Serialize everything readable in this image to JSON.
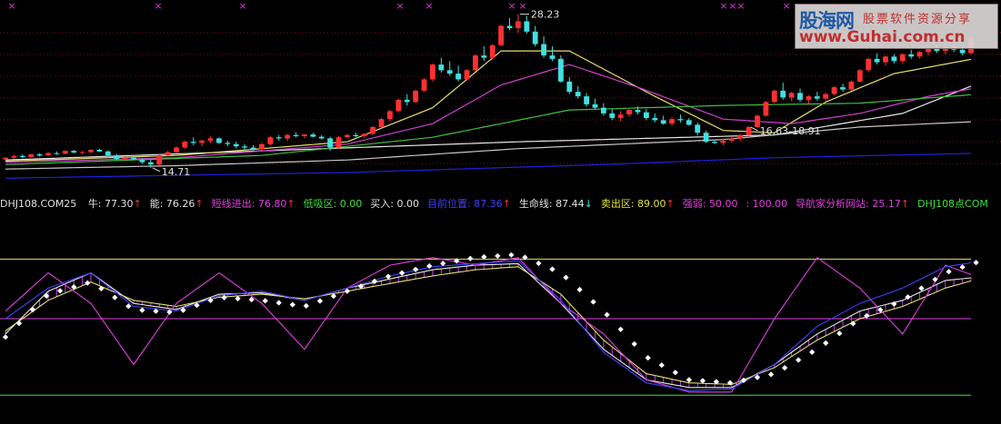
{
  "colors": {
    "background": "#000000",
    "candle_up": "#ff3030",
    "candle_down": "#40e0e0",
    "ma_white": "#e8e8e8",
    "ma_yellow": "#e8e070",
    "ma_magenta": "#d040d0",
    "ma_green": "#40c040",
    "ma_gray": "#c8c8c8",
    "ma_blue": "#2020e0",
    "grid": "#801818"
  },
  "watermark": {
    "brand": "股海网",
    "slogan": "股票软件资源分享",
    "url": "www.Guhai.com.cn"
  },
  "indicator_bar": {
    "title": "DHJ108.COM25",
    "items": [
      {
        "label": "牛: 77.30",
        "arrow": "↑",
        "color": "#e0e0e0",
        "arrow_color": "#ff3030"
      },
      {
        "label": "能: 76.26",
        "arrow": "↑",
        "color": "#e0e0e0",
        "arrow_color": "#ff3030"
      },
      {
        "label": "短线进出: 76.80",
        "arrow": "↑",
        "color": "#e040e0",
        "arrow_color": "#ff3030"
      },
      {
        "label": "低吸区: 0.00",
        "arrow": "",
        "color": "#40e040",
        "arrow_color": ""
      },
      {
        "label": "买入: 0.00",
        "arrow": "",
        "color": "#e0e0e0",
        "arrow_color": ""
      },
      {
        "label": "目前位置: 87.36",
        "arrow": "↑",
        "color": "#4040ff",
        "arrow_color": "#ff3030"
      },
      {
        "label": "生命线: 87.44",
        "arrow": "↓",
        "color": "#e0e0e0",
        "arrow_color": "#40e0e0"
      },
      {
        "label": "卖出区: 89.00",
        "arrow": "↑",
        "color": "#e0e040",
        "arrow_color": "#ff3030"
      },
      {
        "label": "强弱: 50.00",
        "arrow": "",
        "color": "#e040e0",
        "arrow_color": ""
      },
      {
        "label": ": 100.00",
        "arrow": "",
        "color": "#e040e0",
        "arrow_color": ""
      },
      {
        "label": "导航家分析网站: 25.17",
        "arrow": "↑",
        "color": "#e040e0",
        "arrow_color": "#ff3030"
      },
      {
        "label": "DHJ108点COM",
        "arrow": "",
        "color": "#40e040",
        "arrow_color": ""
      }
    ]
  },
  "chart_data": [
    {
      "type": "candlestick",
      "panel": "price",
      "title": "",
      "ylim": [
        13.5,
        29.0
      ],
      "ohlc": [
        [
          15.45,
          15.65,
          15.3,
          15.6
        ],
        [
          15.6,
          15.85,
          15.5,
          15.75
        ],
        [
          15.75,
          15.9,
          15.55,
          15.65
        ],
        [
          15.65,
          15.95,
          15.6,
          15.9
        ],
        [
          15.9,
          16.0,
          15.7,
          15.8
        ],
        [
          15.8,
          16.1,
          15.75,
          16.0
        ],
        [
          16.0,
          16.15,
          15.85,
          15.95
        ],
        [
          15.95,
          16.25,
          15.9,
          16.2
        ],
        [
          16.2,
          16.3,
          16.0,
          16.05
        ],
        [
          16.05,
          16.2,
          15.9,
          16.1
        ],
        [
          16.1,
          16.35,
          16.0,
          16.3
        ],
        [
          16.3,
          16.4,
          16.1,
          16.15
        ],
        [
          16.15,
          16.25,
          15.7,
          15.8
        ],
        [
          15.8,
          15.95,
          15.4,
          15.5
        ],
        [
          15.5,
          15.7,
          15.3,
          15.6
        ],
        [
          15.6,
          15.8,
          15.4,
          15.45
        ],
        [
          15.45,
          15.55,
          15.05,
          15.2
        ],
        [
          15.2,
          15.4,
          14.71,
          15.0
        ],
        [
          15.0,
          15.9,
          14.9,
          15.8
        ],
        [
          15.8,
          16.2,
          15.7,
          16.1
        ],
        [
          16.1,
          16.6,
          16.0,
          16.5
        ],
        [
          16.5,
          17.1,
          16.4,
          17.0
        ],
        [
          17.0,
          17.4,
          16.7,
          16.9
        ],
        [
          16.9,
          17.2,
          16.6,
          17.1
        ],
        [
          17.1,
          17.5,
          16.9,
          17.3
        ],
        [
          17.3,
          17.4,
          16.8,
          16.9
        ],
        [
          16.9,
          17.1,
          16.6,
          16.8
        ],
        [
          16.8,
          17.0,
          16.4,
          16.6
        ],
        [
          16.6,
          16.8,
          16.3,
          16.5
        ],
        [
          16.5,
          16.7,
          16.2,
          16.35
        ],
        [
          16.35,
          16.9,
          16.25,
          16.8
        ],
        [
          16.8,
          17.5,
          16.7,
          17.4
        ],
        [
          17.4,
          17.6,
          17.1,
          17.3
        ],
        [
          17.3,
          17.7,
          17.1,
          17.6
        ],
        [
          17.6,
          17.8,
          17.4,
          17.5
        ],
        [
          17.5,
          17.7,
          17.3,
          17.65
        ],
        [
          17.65,
          17.8,
          17.4,
          17.45
        ],
        [
          17.45,
          17.6,
          17.2,
          17.3
        ],
        [
          17.3,
          17.45,
          16.2,
          16.5
        ],
        [
          16.5,
          17.5,
          16.4,
          17.4
        ],
        [
          17.4,
          17.7,
          17.3,
          17.6
        ],
        [
          17.6,
          17.8,
          17.4,
          17.5
        ],
        [
          17.5,
          17.75,
          17.35,
          17.7
        ],
        [
          17.7,
          18.4,
          17.6,
          18.3
        ],
        [
          18.3,
          19.1,
          18.2,
          19.0
        ],
        [
          19.0,
          19.8,
          18.8,
          19.7
        ],
        [
          19.7,
          20.8,
          19.6,
          20.7
        ],
        [
          20.7,
          21.2,
          20.2,
          20.5
        ],
        [
          20.5,
          21.6,
          20.4,
          21.5
        ],
        [
          21.5,
          22.6,
          21.4,
          22.5
        ],
        [
          22.5,
          23.9,
          22.3,
          23.8
        ],
        [
          23.8,
          24.4,
          23.1,
          23.3
        ],
        [
          23.3,
          24.1,
          22.8,
          23.0
        ],
        [
          23.0,
          23.7,
          22.3,
          22.5
        ],
        [
          22.5,
          23.4,
          22.4,
          23.3
        ],
        [
          23.3,
          24.7,
          23.2,
          24.6
        ],
        [
          24.6,
          25.4,
          24.1,
          24.4
        ],
        [
          24.4,
          25.6,
          24.2,
          25.5
        ],
        [
          25.5,
          27.3,
          25.4,
          27.2
        ],
        [
          27.2,
          27.9,
          26.8,
          27.0
        ],
        [
          27.0,
          28.23,
          26.6,
          27.6
        ],
        [
          27.6,
          28.1,
          26.5,
          26.7
        ],
        [
          26.7,
          27.2,
          25.4,
          25.6
        ],
        [
          25.6,
          26.3,
          24.4,
          24.6
        ],
        [
          24.6,
          25.4,
          24.1,
          24.3
        ],
        [
          24.3,
          24.6,
          22.2,
          22.3
        ],
        [
          22.3,
          22.7,
          21.2,
          21.4
        ],
        [
          21.4,
          21.9,
          20.8,
          21.0
        ],
        [
          21.0,
          21.3,
          20.1,
          20.3
        ],
        [
          20.3,
          20.8,
          19.8,
          20.0
        ],
        [
          20.0,
          20.4,
          19.3,
          19.5
        ],
        [
          19.5,
          19.9,
          18.9,
          19.1
        ],
        [
          19.1,
          19.7,
          18.8,
          19.4
        ],
        [
          19.4,
          19.9,
          19.2,
          19.8
        ],
        [
          19.8,
          20.1,
          19.4,
          19.6
        ],
        [
          19.6,
          19.9,
          18.9,
          19.1
        ],
        [
          19.1,
          19.5,
          18.7,
          18.9
        ],
        [
          18.9,
          19.3,
          18.5,
          18.6
        ],
        [
          18.6,
          19.2,
          18.4,
          19.0
        ],
        [
          19.0,
          19.4,
          18.7,
          18.9
        ],
        [
          18.9,
          19.1,
          18.4,
          18.5
        ],
        [
          18.5,
          18.7,
          17.6,
          17.8
        ],
        [
          17.8,
          18.0,
          16.9,
          17.0
        ],
        [
          17.0,
          17.2,
          16.8,
          16.9
        ],
        [
          16.9,
          17.3,
          16.7,
          17.1
        ],
        [
          17.1,
          17.5,
          16.9,
          17.3
        ],
        [
          17.3,
          17.7,
          17.1,
          17.6
        ],
        [
          17.6,
          18.4,
          17.5,
          18.3
        ],
        [
          18.3,
          19.4,
          18.2,
          19.3
        ],
        [
          19.3,
          20.6,
          19.2,
          20.5
        ],
        [
          20.5,
          21.6,
          20.4,
          21.5
        ],
        [
          21.5,
          22.2,
          20.7,
          20.9
        ],
        [
          20.9,
          21.4,
          20.6,
          21.3
        ],
        [
          21.3,
          21.7,
          20.5,
          20.7
        ],
        [
          20.7,
          21.1,
          20.3,
          21.0
        ],
        [
          21.0,
          21.4,
          20.6,
          20.8
        ],
        [
          20.8,
          21.3,
          20.6,
          21.2
        ],
        [
          21.2,
          21.9,
          21.1,
          21.8
        ],
        [
          21.8,
          22.1,
          21.4,
          21.6
        ],
        [
          21.6,
          22.4,
          21.5,
          22.3
        ],
        [
          22.3,
          23.4,
          22.2,
          23.3
        ],
        [
          23.3,
          24.4,
          23.2,
          24.3
        ],
        [
          24.3,
          24.8,
          23.8,
          24.0
        ],
        [
          24.0,
          24.6,
          23.7,
          24.5
        ],
        [
          24.5,
          24.7,
          23.9,
          24.1
        ],
        [
          24.1,
          24.8,
          23.9,
          24.7
        ],
        [
          24.7,
          25.1,
          24.3,
          24.5
        ],
        [
          24.5,
          25.0,
          24.3,
          24.9
        ],
        [
          24.9,
          25.3,
          24.6,
          25.2
        ],
        [
          25.2,
          25.5,
          24.8,
          25.0
        ],
        [
          25.0,
          25.4,
          24.7,
          25.3
        ],
        [
          25.3,
          25.6,
          24.9,
          25.1
        ],
        [
          25.1,
          25.4,
          24.6,
          24.8
        ],
        [
          24.8,
          26.2,
          24.7,
          26.0
        ]
      ],
      "series": [
        {
          "color": "#e8e8e8",
          "values": [
            [
              0,
              15.4
            ],
            [
              30,
              16.2
            ],
            [
              60,
              17.0
            ],
            [
              90,
              17.6
            ],
            [
              105,
              19.5
            ],
            [
              114,
              22.2
            ]
          ]
        },
        {
          "color": "#e8e070",
          "values": [
            [
              0,
              15.3
            ],
            [
              20,
              15.8
            ],
            [
              40,
              17.0
            ],
            [
              50,
              20.0
            ],
            [
              58,
              25.0
            ],
            [
              66,
              25.0
            ],
            [
              76,
              21.0
            ],
            [
              84,
              18.0
            ],
            [
              90,
              17.8
            ],
            [
              96,
              20.5
            ],
            [
              104,
              23.0
            ],
            [
              114,
              24.4
            ]
          ]
        },
        {
          "color": "#d040d0",
          "values": [
            [
              0,
              15.2
            ],
            [
              20,
              15.6
            ],
            [
              40,
              16.8
            ],
            [
              50,
              18.6
            ],
            [
              58,
              22.0
            ],
            [
              66,
              23.8
            ],
            [
              74,
              21.8
            ],
            [
              84,
              19.0
            ],
            [
              92,
              18.6
            ],
            [
              100,
              19.5
            ],
            [
              108,
              21.0
            ],
            [
              114,
              21.8
            ]
          ]
        },
        {
          "color": "#40c040",
          "values": [
            [
              0,
              15.0
            ],
            [
              30,
              15.8
            ],
            [
              50,
              17.4
            ],
            [
              66,
              19.8
            ],
            [
              84,
              20.2
            ],
            [
              100,
              20.4
            ],
            [
              114,
              21.2
            ]
          ]
        },
        {
          "color": "#c8c8c8",
          "values": [
            [
              0,
              14.6
            ],
            [
              20,
              14.9
            ],
            [
              40,
              15.4
            ],
            [
              60,
              16.4
            ],
            [
              84,
              17.2
            ],
            [
              100,
              18.3
            ],
            [
              114,
              18.8
            ]
          ]
        },
        {
          "color": "#2020e0",
          "values": [
            [
              0,
              13.8
            ],
            [
              40,
              14.3
            ],
            [
              70,
              15.0
            ],
            [
              90,
              15.6
            ],
            [
              114,
              16.0
            ]
          ]
        }
      ],
      "annotations": [
        {
          "text": "28.23",
          "x": 60,
          "y": 28.23
        },
        {
          "text": "14.71",
          "x": 17,
          "y": 14.71
        },
        {
          "text": "16.63-18.91",
          "x": 87,
          "y": 18.3
        }
      ],
      "grid": true
    },
    {
      "type": "line",
      "panel": "indicator",
      "title": "DHJ108.COM25",
      "ylim": [
        -10,
        110
      ],
      "x": [
        0,
        5,
        10,
        15,
        20,
        25,
        30,
        35,
        40,
        45,
        50,
        55,
        60,
        65,
        70,
        75,
        80,
        85,
        90,
        95,
        100,
        105,
        110,
        114
      ],
      "series": [
        {
          "name": "牛",
          "color": "#e8e8e8",
          "values": [
            40,
            68,
            80,
            60,
            56,
            66,
            67,
            62,
            70,
            76,
            82,
            85,
            86,
            60,
            30,
            10,
            5,
            5,
            20,
            40,
            55,
            62,
            75,
            77.3
          ]
        },
        {
          "name": "能",
          "color": "#e8e070",
          "values": [
            42,
            62,
            74,
            62,
            58,
            64,
            66,
            63,
            68,
            73,
            78,
            82,
            84,
            66,
            36,
            14,
            8,
            7,
            18,
            36,
            50,
            58,
            70,
            76.26
          ]
        },
        {
          "name": "短线进出",
          "color": "#e040e0",
          "values": [
            55,
            80,
            60,
            20,
            60,
            80,
            60,
            30,
            70,
            85,
            90,
            85,
            90,
            60,
            40,
            10,
            2,
            2,
            50,
            90,
            70,
            40,
            85,
            76.8
          ]
        },
        {
          "name": "目前位置",
          "color": "#4040ff",
          "values": [
            50,
            70,
            80,
            58,
            55,
            65,
            68,
            62,
            70,
            78,
            84,
            86,
            88,
            62,
            28,
            8,
            3,
            4,
            20,
            45,
            60,
            70,
            84,
            87.36
          ]
        },
        {
          "name": "生命线",
          "color": "#ffffff",
          "values": [
            38,
            66,
            74,
            56,
            54,
            64,
            62,
            58,
            68,
            78,
            85,
            90,
            92,
            80,
            55,
            25,
            10,
            8,
            14,
            30,
            50,
            62,
            80,
            87.44
          ]
        }
      ],
      "levels": [
        {
          "name": "卖出区",
          "value": 89.0,
          "color": "#e8e070"
        },
        {
          "name": "强弱",
          "value": 50.0,
          "color": "#e040e0"
        },
        {
          "name": "低吸区",
          "value": 0.0,
          "color": "#40e040"
        }
      ],
      "grid": false
    }
  ]
}
